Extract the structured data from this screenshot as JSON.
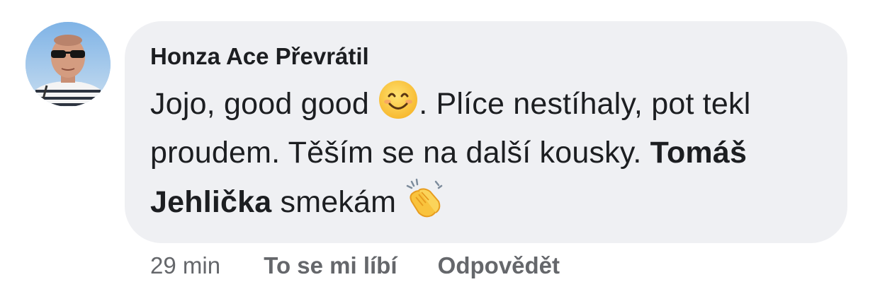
{
  "comment": {
    "author": "Honza Ace Převrátil",
    "text_1": "Jojo, good good ",
    "emoji_1": "smiling-face-emoji",
    "text_2": ". Plíce nestíhaly, pot tekl proudem. Těším se na další kousky. ",
    "mention": "Tomáš Jehlička",
    "text_3": " smekám ",
    "emoji_2": "clapping-hands-emoji",
    "colors": {
      "bubble": "#eff0f3",
      "text": "#1c1e21",
      "secondary": "#65676b"
    }
  },
  "actions": {
    "time": "29 min",
    "like_label": "To se mi líbí",
    "reply_label": "Odpovědět"
  }
}
